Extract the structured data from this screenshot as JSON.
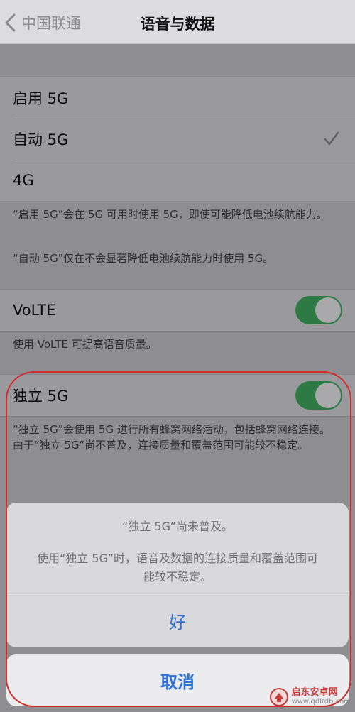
{
  "nav": {
    "back_label": "中国联通",
    "title": "语音与数据"
  },
  "options": [
    {
      "label": "启用 5G",
      "selected": false
    },
    {
      "label": "自动 5G",
      "selected": true
    },
    {
      "label": "4G",
      "selected": false
    }
  ],
  "options_footer": {
    "line1": "“启用 5G”会在 5G 可用时使用 5G，即使可能降低电池续航能力。",
    "line2": "“自动 5G”仅在不会显著降低电池续航能力时使用 5G。"
  },
  "volte": {
    "label": "VoLTE",
    "enabled": true,
    "footer": "使用 VoLTE 可提高语音质量。"
  },
  "sa5g": {
    "label": "独立 5G",
    "enabled": true,
    "footer": "“独立 5G”会使用 5G 进行所有蜂窝网络活动，包括蜂窝网络连接。由于“独立 5G”尚不普及，连接质量和覆盖范围可能较不稳定。"
  },
  "alert": {
    "title": "“独立 5G”尚未普及。",
    "message": "使用“独立 5G”时，语音及数据的连接质量和覆盖范围可能较不稳定。",
    "ok_label": "好",
    "cancel_label": "取消"
  },
  "watermark": {
    "name": "启东安卓网",
    "url": "www.qdltdb.com"
  },
  "colors": {
    "accent": "#2f6fd8",
    "toggle_on": "#2d7a44",
    "highlight": "#d32a2a"
  },
  "icons": [
    "chevron-left-icon",
    "checkmark-icon",
    "watermark-logo-icon"
  ]
}
